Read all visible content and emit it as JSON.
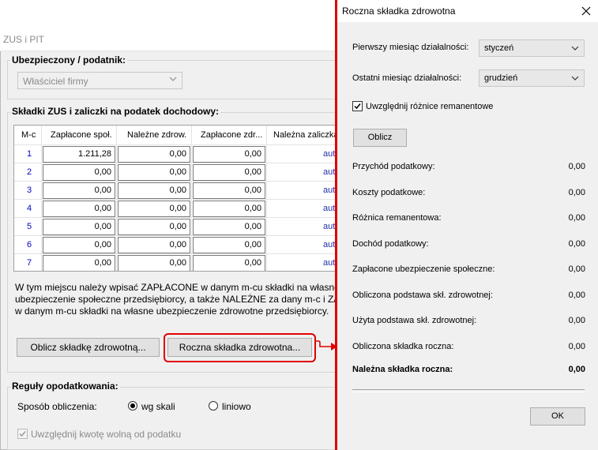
{
  "bg_window": {
    "title": "ZUS i PIT",
    "insured_group": "Ubezpieczony / podatnik:",
    "insured_value": "Właściciel firmy",
    "contrib_group": "Składki ZUS i zaliczki na podatek dochodowy:",
    "table": {
      "headers": [
        "M-c",
        "Zapłacone społ.",
        "Należne zdrow.",
        "Zapłacone zdr...",
        "Należna zaliczka"
      ],
      "rows": [
        {
          "m": "1",
          "paid_social": "1.211,28",
          "due_health": "0,00",
          "paid_health": "0,00",
          "advance": "auto"
        },
        {
          "m": "2",
          "paid_social": "0,00",
          "due_health": "0,00",
          "paid_health": "0,00",
          "advance": "auto"
        },
        {
          "m": "3",
          "paid_social": "0,00",
          "due_health": "0,00",
          "paid_health": "0,00",
          "advance": "auto"
        },
        {
          "m": "4",
          "paid_social": "0,00",
          "due_health": "0,00",
          "paid_health": "0,00",
          "advance": "auto"
        },
        {
          "m": "5",
          "paid_social": "0,00",
          "due_health": "0,00",
          "paid_health": "0,00",
          "advance": "auto"
        },
        {
          "m": "6",
          "paid_social": "0,00",
          "due_health": "0,00",
          "paid_health": "0,00",
          "advance": "auto"
        },
        {
          "m": "7",
          "paid_social": "0,00",
          "due_health": "0,00",
          "paid_health": "0,00",
          "advance": "auto"
        }
      ]
    },
    "info_lines": [
      "W tym miejscu należy wpisać ZAPŁACONE w danym m-cu składki na własne",
      "ubezpieczenie społeczne przedsiębiorcy, a także NALEŻNE za dany m-c i ZAPŁACO",
      "w danym m-cu składki na własne ubezpieczenie zdrowotne przedsiębiorcy."
    ],
    "btn_calc_health": "Oblicz składkę zdrowotną...",
    "btn_annual_health": "Roczna składka zdrowotna...",
    "tax_rules_group": "Reguły opodatkowania:",
    "calc_method_label": "Sposób obliczenia:",
    "radio_scale": "wg skali",
    "radio_linear": "liniowo",
    "free_amount_check": "Uwzględnij kwotę wolną od podatku"
  },
  "dialog": {
    "title": "Roczna składka zdrowotna",
    "first_month_label": "Pierwszy miesiąc działalności:",
    "first_month_value": "styczeń",
    "last_month_label": "Ostatni miesiąc działalności:",
    "last_month_value": "grudzień",
    "inventory_check": "Uwzględnij różnice remanentowe",
    "calc_button": "Oblicz",
    "results": [
      {
        "label": "Przychód podatkowy:",
        "value": "0,00"
      },
      {
        "label": "Koszty podatkowe:",
        "value": "0,00"
      },
      {
        "label": "Różnica remanentowa:",
        "value": "0,00"
      },
      {
        "label": "Dochód podatkowy:",
        "value": "0,00"
      },
      {
        "label": "Zapłacone ubezpieczenie społeczne:",
        "value": "0,00"
      },
      {
        "label": "Obliczona podstawa skł. zdrowotnej:",
        "value": "0,00"
      },
      {
        "label": "Użyta podstawa skł. zdrowotnej:",
        "value": "0,00"
      },
      {
        "label": "Obliczona składka roczna:",
        "value": "0,00"
      }
    ],
    "due_label": "Należna składka roczna:",
    "due_value": "0,00",
    "ok_button": "OK"
  },
  "colors": {
    "highlight": "#e00000",
    "auto_text": "#1f2faa",
    "row_num": "#0000c8"
  }
}
